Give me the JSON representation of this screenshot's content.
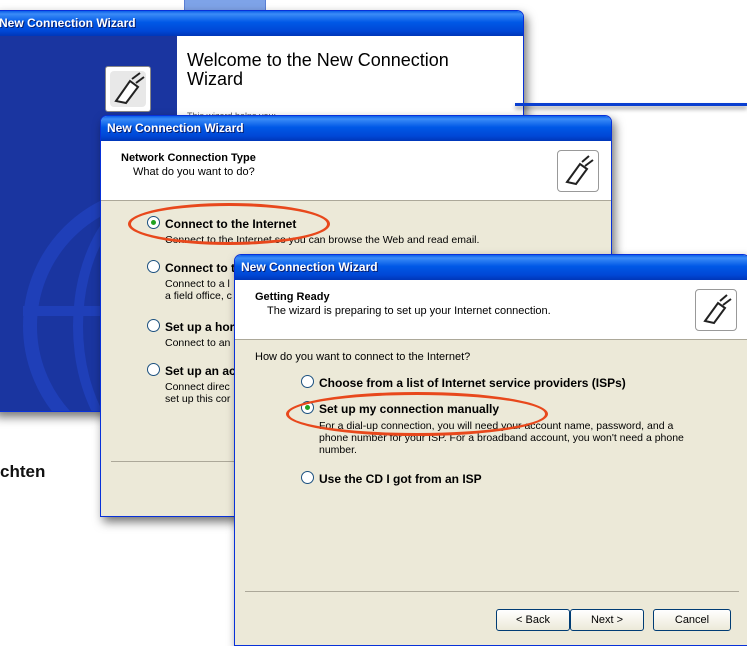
{
  "window1": {
    "title": "New Connection Wizard",
    "welcome_heading": "Welcome to the New Connection Wizard",
    "welcome_sub": "This wizard helps you:"
  },
  "window2": {
    "title": "New Connection Wizard",
    "header_title": "Network Connection Type",
    "header_subtitle": "What do you want to do?",
    "options": [
      {
        "label": "Connect to the Internet",
        "desc": "Connect to the Internet so you can browse the Web and read email.",
        "selected": true
      },
      {
        "label": "Connect to t",
        "desc": "Connect to a l\na field office, c"
      },
      {
        "label": "Set up a hor",
        "desc": "Connect to an"
      },
      {
        "label": "Set up an ac",
        "desc": "Connect direc\nset up this cor"
      }
    ]
  },
  "window3": {
    "title": "New Connection Wizard",
    "header_title": "Getting Ready",
    "header_subtitle": "The wizard is preparing to set up your Internet connection.",
    "question": "How do you want to connect to the Internet?",
    "options": [
      {
        "label": "Choose from a list of Internet service providers (ISPs)"
      },
      {
        "label": "Set up my connection manually",
        "selected": true,
        "desc": "For a dial-up connection, you will need your account name, password, and a\nphone number for your ISP. For a broadband account, you won't need a phone\nnumber."
      },
      {
        "label": "Use the CD I got from an ISP"
      }
    ],
    "buttons": {
      "back": "< Back",
      "next": "Next >",
      "cancel": "Cancel"
    }
  },
  "side_label": "chten",
  "colors": {
    "titlebar": "#0058e6",
    "highlight": "#e8481c",
    "dialog_bg": "#ece9d8"
  }
}
